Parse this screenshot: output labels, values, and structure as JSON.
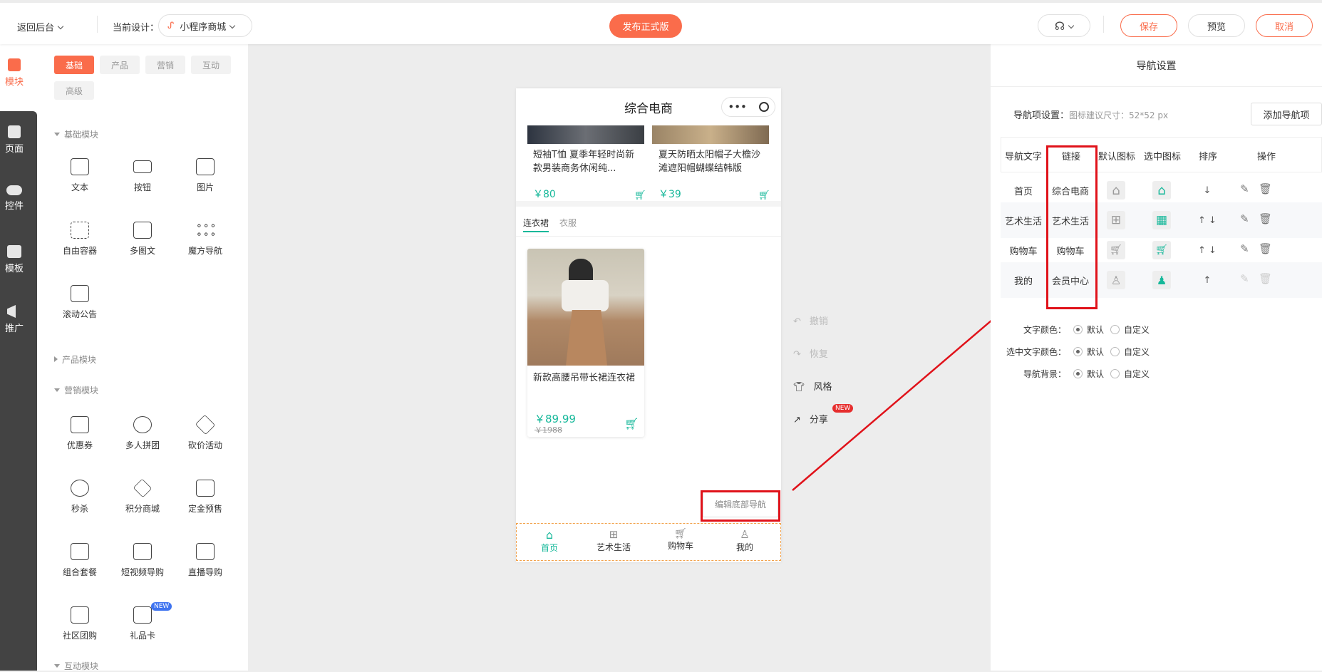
{
  "topbar": {
    "back_label": "返回后台",
    "current_design_label": "当前设计：",
    "design_name": "小程序商城",
    "publish_label": "发布正式版",
    "save_label": "保存",
    "preview_label": "预览",
    "cancel_label": "取消"
  },
  "iconbar": {
    "items": [
      {
        "label": "模块"
      },
      {
        "label": "页面"
      },
      {
        "label": "控件"
      },
      {
        "label": "模板"
      },
      {
        "label": "推广"
      }
    ]
  },
  "panel": {
    "tabs": [
      "基础",
      "产品",
      "营销",
      "互动",
      "高级"
    ],
    "sections": {
      "basic": "基础模块",
      "product": "产品模块",
      "marketing": "营销模块",
      "interactive": "互动模块"
    },
    "basic_modules": [
      "文本",
      "按钮",
      "图片",
      "自由容器",
      "多图文",
      "魔方导航",
      "滚动公告"
    ],
    "marketing_modules": [
      "优惠券",
      "多人拼团",
      "砍价活动",
      "秒杀",
      "积分商城",
      "定金预售",
      "组合套餐",
      "短视频导购",
      "直播导购",
      "社区团购",
      "礼品卡"
    ],
    "new_badge": "NEW"
  },
  "phone": {
    "title": "综合电商",
    "products_top": [
      {
        "name": "短袖T恤 夏季年轻时尚新款男装商务休闲纯...",
        "price": "￥80"
      },
      {
        "name": "夏天防晒太阳帽子大檐沙滩遮阳帽蝴蝶结韩版",
        "price": "￥39"
      }
    ],
    "tabs": [
      "连衣裙",
      "衣服"
    ],
    "product_main": {
      "name": "新款高腰吊带长裙连衣裙",
      "price": "￥89.99",
      "old_price": "￥1988"
    },
    "edit_nav_label": "编辑底部导航",
    "bottom_nav": [
      "首页",
      "艺术生活",
      "购物车",
      "我的"
    ]
  },
  "side_tools": [
    {
      "label": "撤销"
    },
    {
      "label": "恢复"
    },
    {
      "label": "风格"
    },
    {
      "label": "分享",
      "badge": "NEW"
    }
  ],
  "settings": {
    "title": "导航设置",
    "nav_item_label": "导航项设置：",
    "hint": "图标建议尺寸：52*52 px",
    "add_button": "添加导航项",
    "headers": [
      "导航文字",
      "链接",
      "默认图标",
      "选中图标",
      "排序",
      "操作"
    ],
    "rows": [
      {
        "text": "首页",
        "link": "综合电商",
        "sort": "↓"
      },
      {
        "text": "艺术生活",
        "link": "艺术生活",
        "sort": "↑ ↓"
      },
      {
        "text": "购物车",
        "link": "购物车",
        "sort": "↑ ↓"
      },
      {
        "text": "我的",
        "link": "会员中心",
        "sort": "↑"
      }
    ],
    "options": [
      {
        "label": "文字颜色：",
        "default": "默认",
        "custom": "自定义"
      },
      {
        "label": "选中文字颜色：",
        "default": "默认",
        "custom": "自定义"
      },
      {
        "label": "导航背景：",
        "default": "默认",
        "custom": "自定义"
      }
    ]
  },
  "colors": {
    "accent": "#fa6c4b",
    "teal": "#16b89a",
    "annotation": "#e0121a"
  }
}
